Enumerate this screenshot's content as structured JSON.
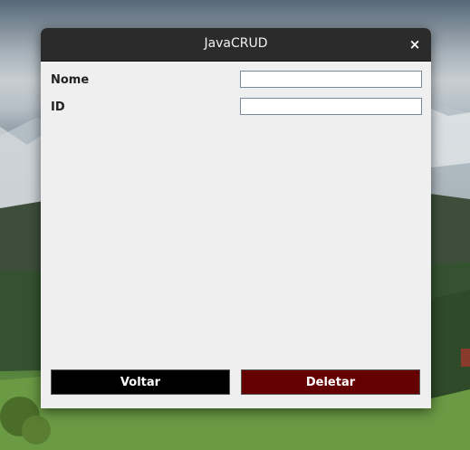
{
  "window": {
    "title": "JavaCRUD",
    "close_icon": "×"
  },
  "form": {
    "nome_label": "Nome",
    "nome_value": "",
    "id_label": "ID",
    "id_value": ""
  },
  "buttons": {
    "voltar_label": "Voltar",
    "deletar_label": "Deletar"
  },
  "colors": {
    "titlebar": "#2b2b2b",
    "window_bg": "#efefef",
    "voltar_bg": "#000000",
    "deletar_bg": "#650000"
  }
}
